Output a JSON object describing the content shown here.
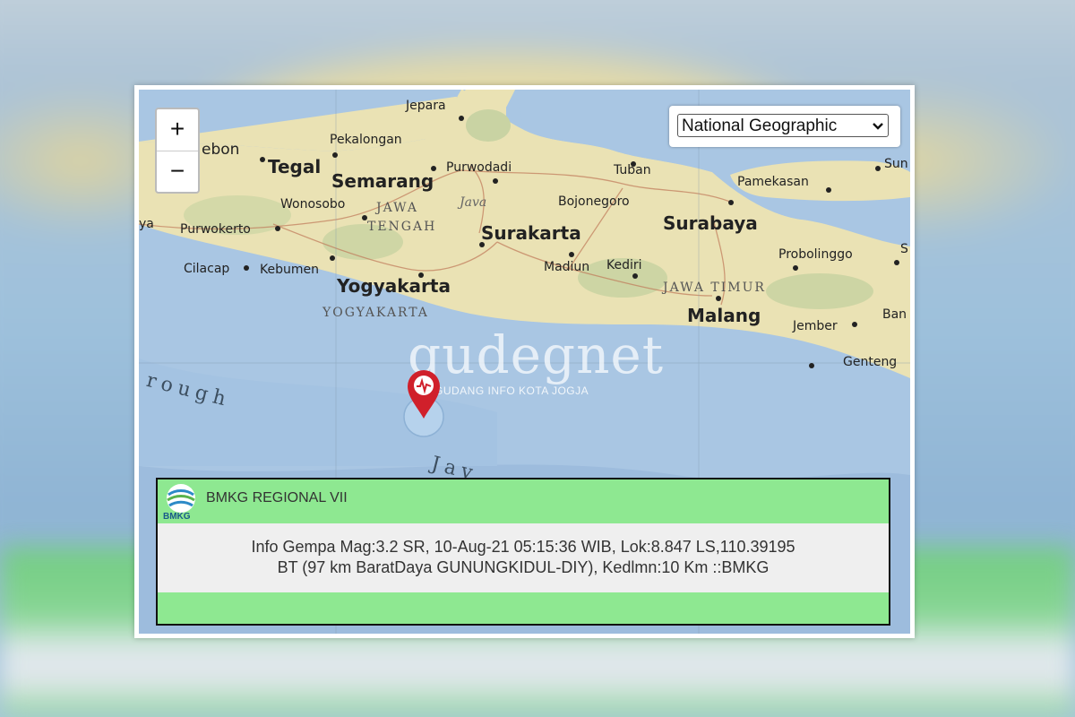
{
  "map": {
    "zoom_in": "+",
    "zoom_out": "−",
    "basemap_selected": "National Geographic",
    "cities": {
      "jepara": "Jepara",
      "pekalongan": "Pekalongan",
      "cirebon": "ebon",
      "tegal": "Tegal",
      "semarang": "Semarang",
      "purwodadi": "Purwodadi",
      "tuban": "Tuban",
      "pamekasan": "Pamekasan",
      "sumenep": "Sun",
      "wonosobo": "Wonosobo",
      "java": "Java",
      "bojonegoro": "Bojonegoro",
      "surabaya": "Surabaya",
      "banjar": "ya",
      "purwokerto": "Purwokerto",
      "surakarta": "Surakarta",
      "probolinggo": "Probolinggo",
      "s_east": "S",
      "cilacap": "Cilacap",
      "kebumen": "Kebumen",
      "madiun": "Madiun",
      "kediri": "Kediri",
      "yogyakarta": "Yogyakarta",
      "malang": "Malang",
      "jember": "Jember",
      "ban": "Ban",
      "genteng": "Genteng"
    },
    "regions": {
      "jateng_1": "JAWA",
      "jateng_2": "TENGAH",
      "jatim": "JAWA TIMUR",
      "diy": "YOGYAKARTA"
    },
    "sea": {
      "trough": "rough",
      "java_sea": "Jav"
    },
    "watermark": {
      "main": "gudegnet",
      "sub": "GUDANG INFO  KOTA JOGJA"
    }
  },
  "info": {
    "logo_text": "BMKG",
    "title": "BMKG REGIONAL VII",
    "line1": "Info Gempa Mag:3.2 SR, 10-Aug-21 05:15:36 WIB, Lok:8.847 LS,110.39195",
    "line2": "BT (97 km BaratDaya GUNUNGKIDUL-DIY), Kedlmn:10 Km ::BMKG"
  },
  "colors": {
    "land": "#eae2b4",
    "sea": "#a9c6e3",
    "info_green": "#8ee891",
    "marker": "#d0202b"
  }
}
